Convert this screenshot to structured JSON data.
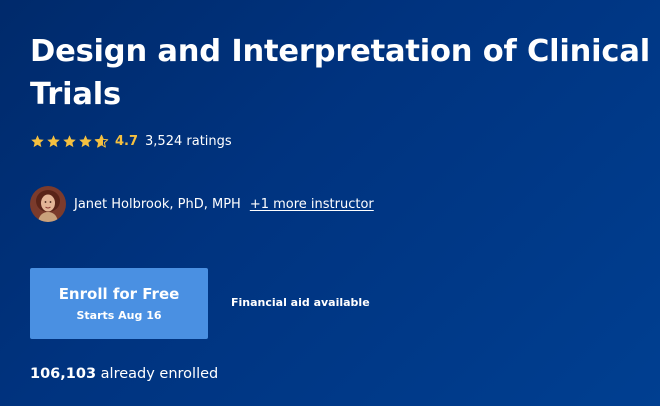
{
  "course": {
    "title": "Design and Interpretation of Clinical Trials"
  },
  "rating": {
    "value": "4.7",
    "stars": 4.7,
    "count_text": "3,524 ratings"
  },
  "instructors": {
    "primary": "Janet Holbrook, PhD, MPH",
    "more_link": "+1 more instructor"
  },
  "enroll": {
    "button_label": "Enroll for Free",
    "start_text": "Starts Aug 16",
    "financial_aid": "Financial aid available"
  },
  "enrollment": {
    "count": "106,103",
    "suffix": "already enrolled"
  },
  "colors": {
    "background": "#00337f",
    "button": "#4a90e2",
    "star": "#f5c040",
    "text": "#ffffff"
  },
  "icons": {
    "star": "star-icon",
    "avatar": "instructor-avatar"
  }
}
